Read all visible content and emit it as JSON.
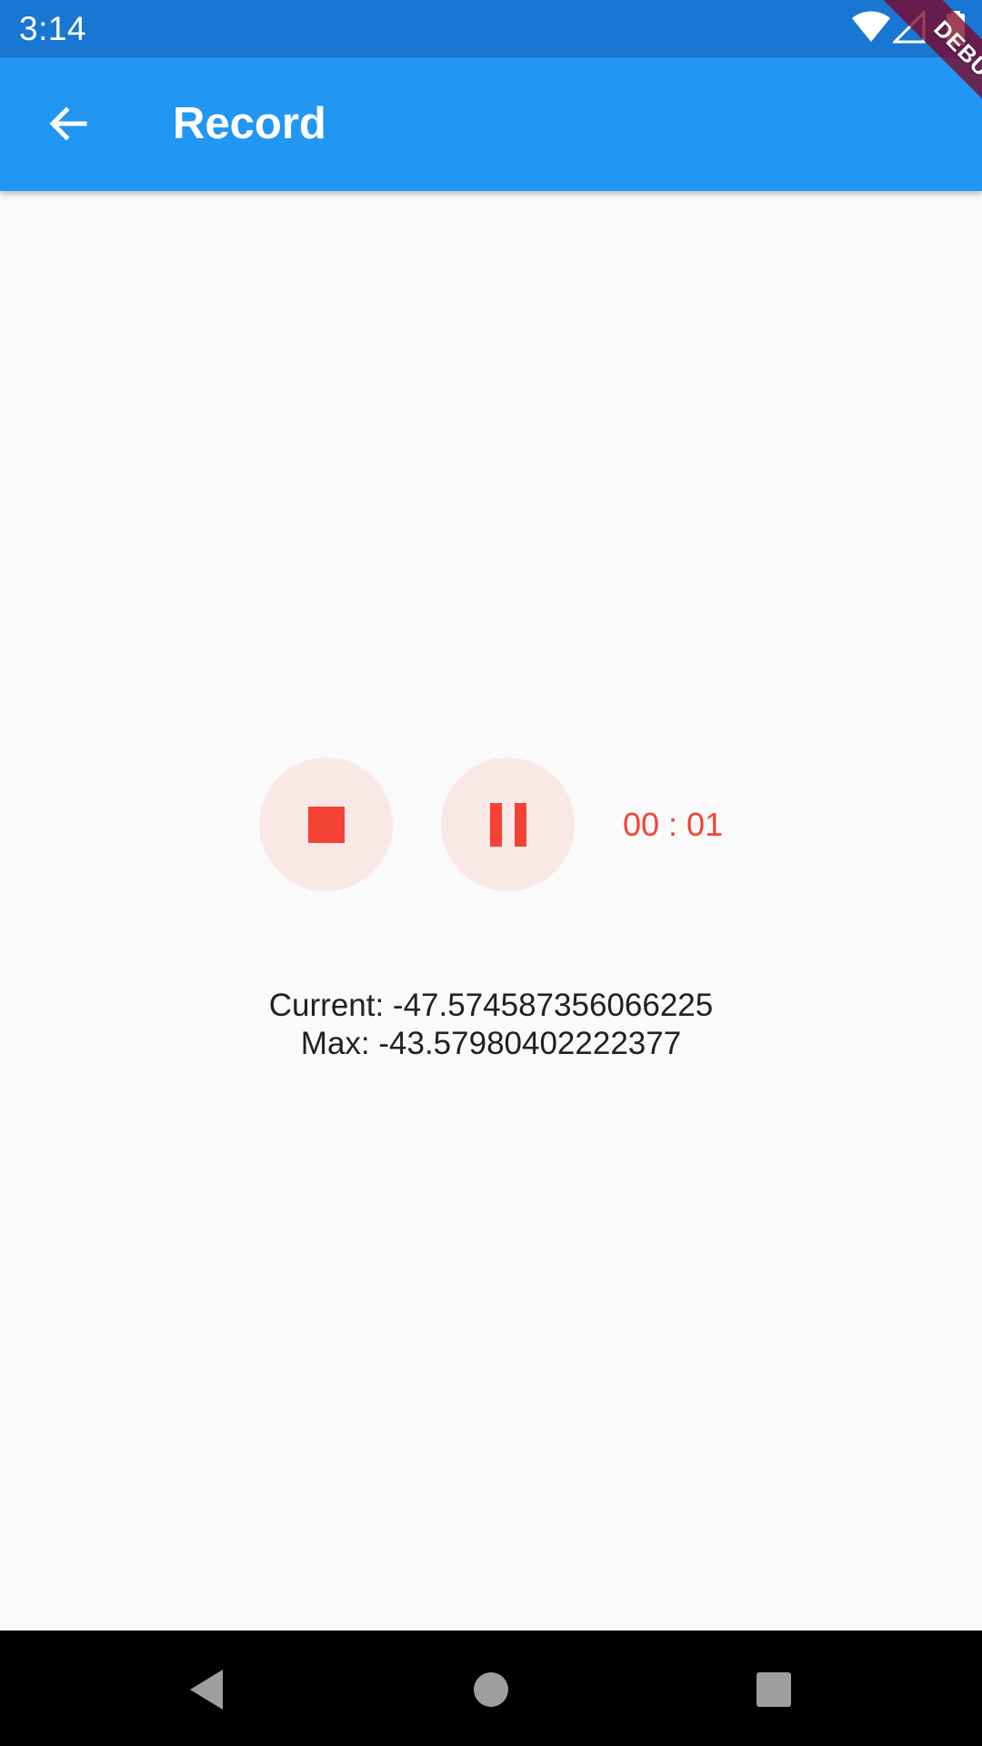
{
  "status_bar": {
    "time": "3:14",
    "icons": [
      "wifi-icon",
      "cell-signal-icon",
      "battery-icon"
    ]
  },
  "debug_banner": {
    "label": "DEBUG"
  },
  "app_bar": {
    "title": "Record",
    "back_icon": "arrow-back-icon",
    "color": "#2196f3"
  },
  "recorder": {
    "stop_icon": "stop-icon",
    "pause_icon": "pause-icon",
    "timer": "00 : 01",
    "accent_color": "#f44336"
  },
  "amplitude": {
    "current_label": "Current: -47.574587356066225",
    "max_label": "Max: -43.57980402222377"
  },
  "nav_bar": {
    "buttons": [
      "back-triangle-icon",
      "home-circle-icon",
      "recents-square-icon"
    ]
  }
}
